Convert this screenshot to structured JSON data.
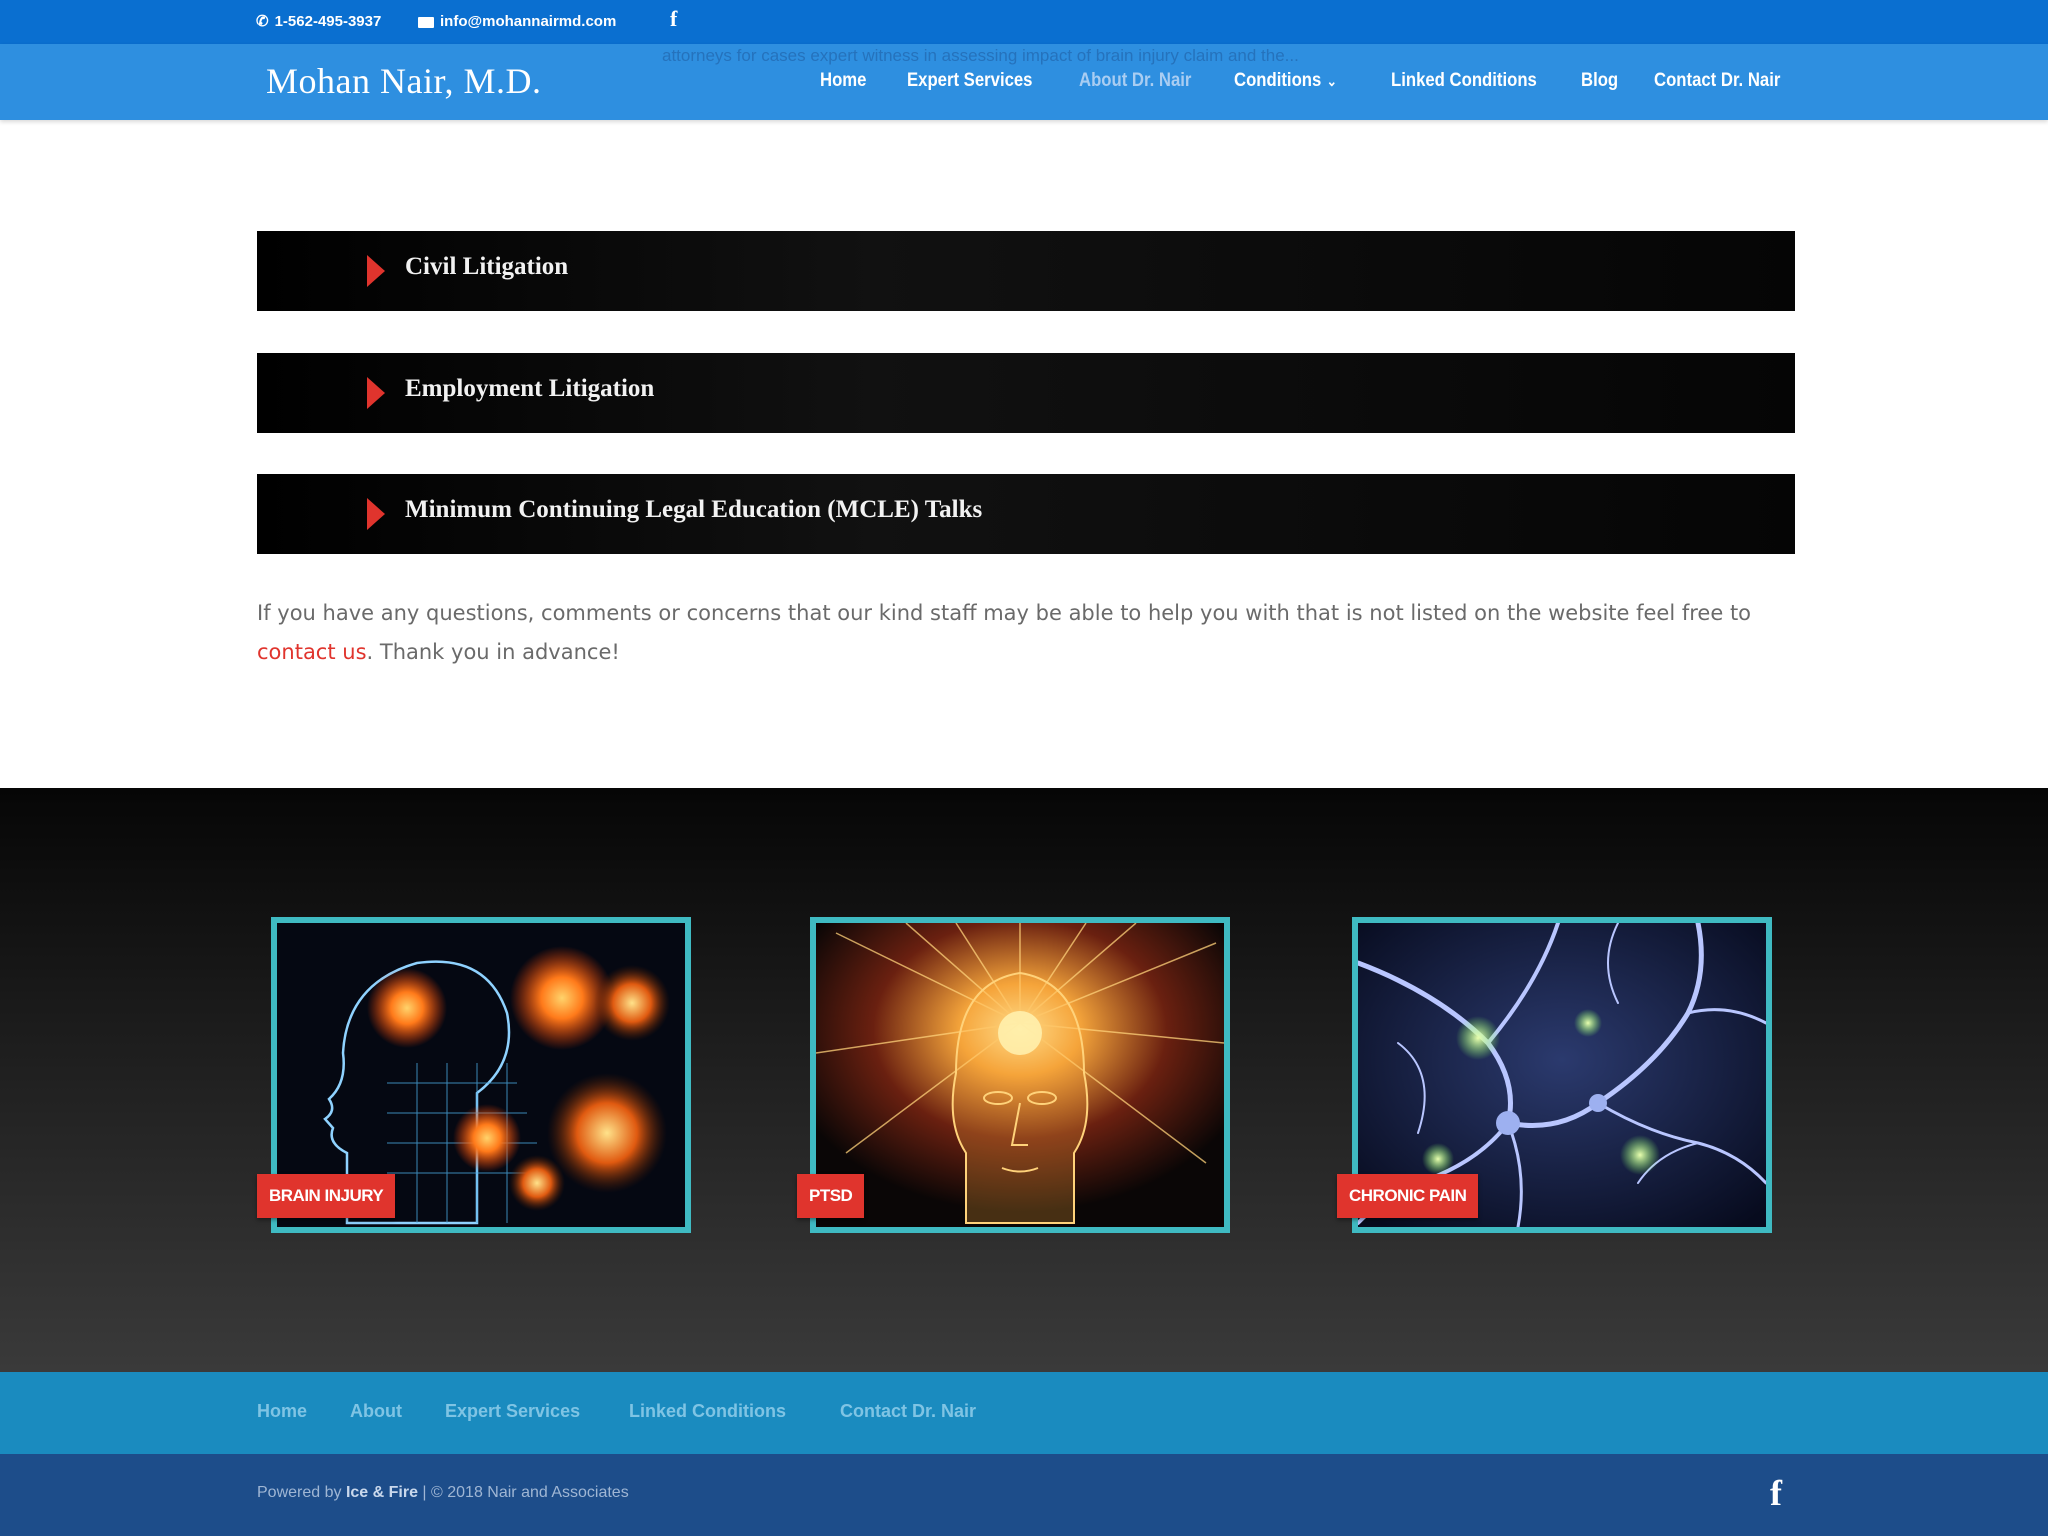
{
  "topbar": {
    "phone": "1-562-495-3937",
    "email": "info@mohannairmd.com",
    "facebook_icon": "facebook-icon"
  },
  "header": {
    "logo": "Mohan Nair, M.D.",
    "ghost_text": "attorneys for cases expert witness in assessing impact of brain injury claim and the...",
    "nav": [
      {
        "label": "Home"
      },
      {
        "label": "Expert Services"
      },
      {
        "label": "About Dr. Nair",
        "active": true
      },
      {
        "label": "Conditions",
        "caret": "chevron-down-icon"
      },
      {
        "label": "Linked Conditions"
      },
      {
        "label": "Blog"
      },
      {
        "label": "Contact Dr. Nair"
      }
    ]
  },
  "accordions": [
    {
      "title": "Civil Litigation"
    },
    {
      "title": "Employment Litigation"
    },
    {
      "title": "Minimum Continuing Legal Education (MCLE) Talks"
    }
  ],
  "intro": {
    "text": "If you have any questions, comments or concerns that our kind staff may be able to help you with that is not listed on the website feel free to ",
    "link": "contact us",
    "suffix": ". Thank you in advance!"
  },
  "cards": [
    {
      "tag": "BRAIN INJURY",
      "image": "brain-injury-image"
    },
    {
      "tag": "PTSD",
      "image": "ptsd-image"
    },
    {
      "tag": "CHRONIC PAIN",
      "image": "neurons-image"
    }
  ],
  "footer_nav": [
    "Home",
    "About",
    "Expert Services",
    "Linked Conditions",
    "Contact Dr. Nair"
  ],
  "credits": {
    "prefix": "Powered by ",
    "agency": "Ice & Fire",
    "suffix": " | © 2018 Nair and Associates"
  },
  "colors": {
    "topbar": "#0a6fd0",
    "header": "#2e8fe0",
    "accent_red": "#e0342d",
    "card_border": "#3fbac2",
    "footer_nav": "#1a8bbf",
    "bottom_bar": "#1d4d8a"
  }
}
